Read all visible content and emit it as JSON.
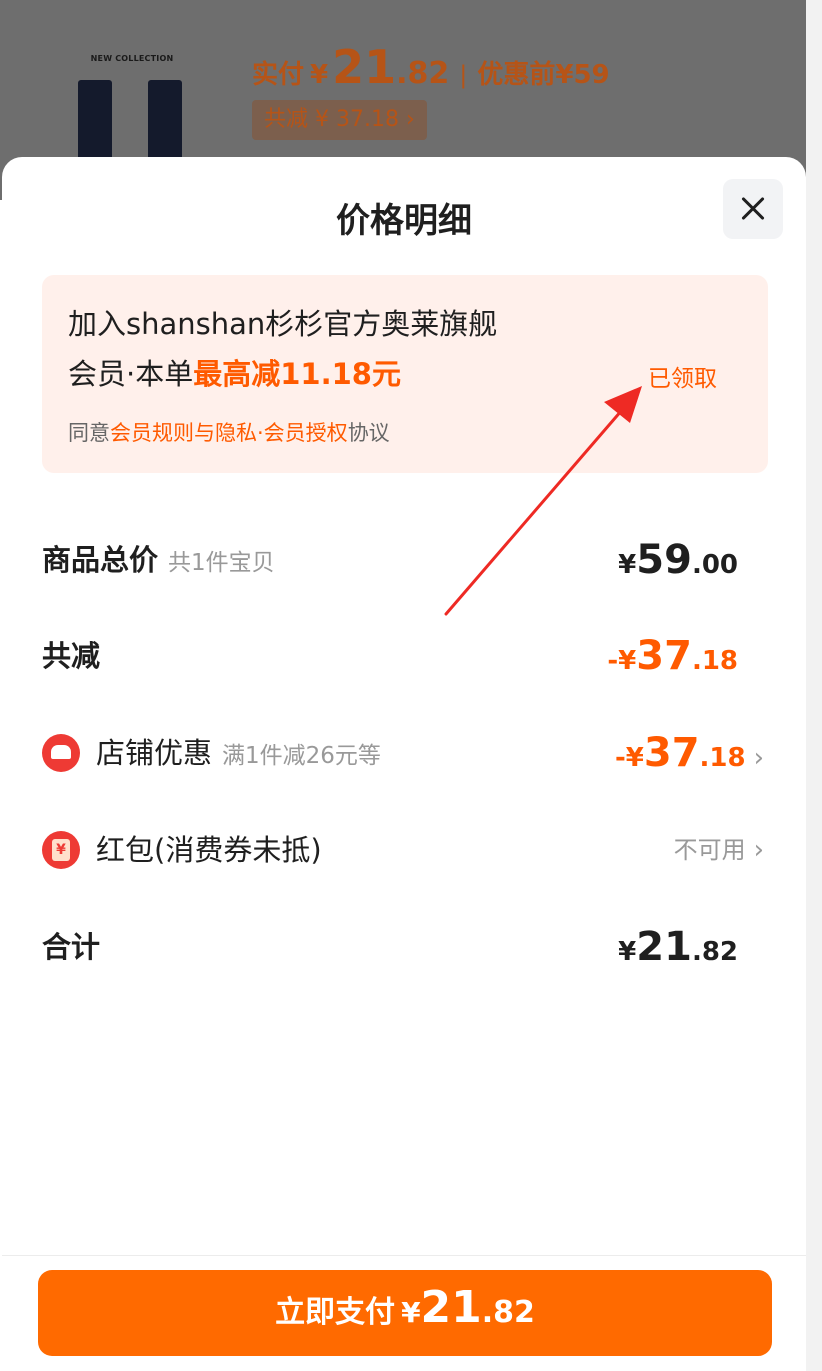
{
  "product_header": {
    "collection_text": "NEW COLLECTION",
    "paid_label": "实付",
    "paid_yen": "¥",
    "paid_int": "21",
    "paid_dec": ".82",
    "separator": "|",
    "before_discount": "优惠前¥59",
    "total_discount": "共减 ¥ 37.18 ›"
  },
  "sheet": {
    "title": "价格明细"
  },
  "member_card": {
    "line1": "加入shanshan杉杉官方奥莱旗舰",
    "line2_prefix": "会员·本单",
    "line2_highlight": "最高减11.18元",
    "agree_prefix": "同意",
    "agree_link": "会员规则与隐私·会员授权",
    "agree_suffix": "协议",
    "claimed": "已领取"
  },
  "rows": {
    "goods": {
      "label": "商品总价",
      "sub": "共1件宝贝",
      "yen": "¥",
      "int": "59",
      "dec": ".00"
    },
    "reduction": {
      "label": "共减",
      "yen": "-¥",
      "int": "37",
      "dec": ".18"
    },
    "shop_discount": {
      "label": "店铺优惠",
      "sub": "满1件减26元等",
      "yen": "-¥",
      "int": "37",
      "dec": ".18",
      "chevron": "›"
    },
    "red_packet": {
      "label": "红包(消费券未抵)",
      "value": "不可用",
      "chevron": "›",
      "icon_glyph": "¥"
    },
    "total": {
      "label": "合计",
      "yen": "¥",
      "int": "21",
      "dec": ".82"
    }
  },
  "pay_button": {
    "label": "立即支付",
    "yen": "¥",
    "int": "21",
    "dec": ".82"
  },
  "colors": {
    "accent": "#ff6a00",
    "highlight": "#ff5a00",
    "arrow": "#ee2a24",
    "card_bg": "#fff0eb",
    "icon_red": "#ee3a34"
  },
  "icons": [
    "close-icon",
    "shop-discount-icon",
    "red-packet-icon",
    "chevron-right-icon"
  ]
}
